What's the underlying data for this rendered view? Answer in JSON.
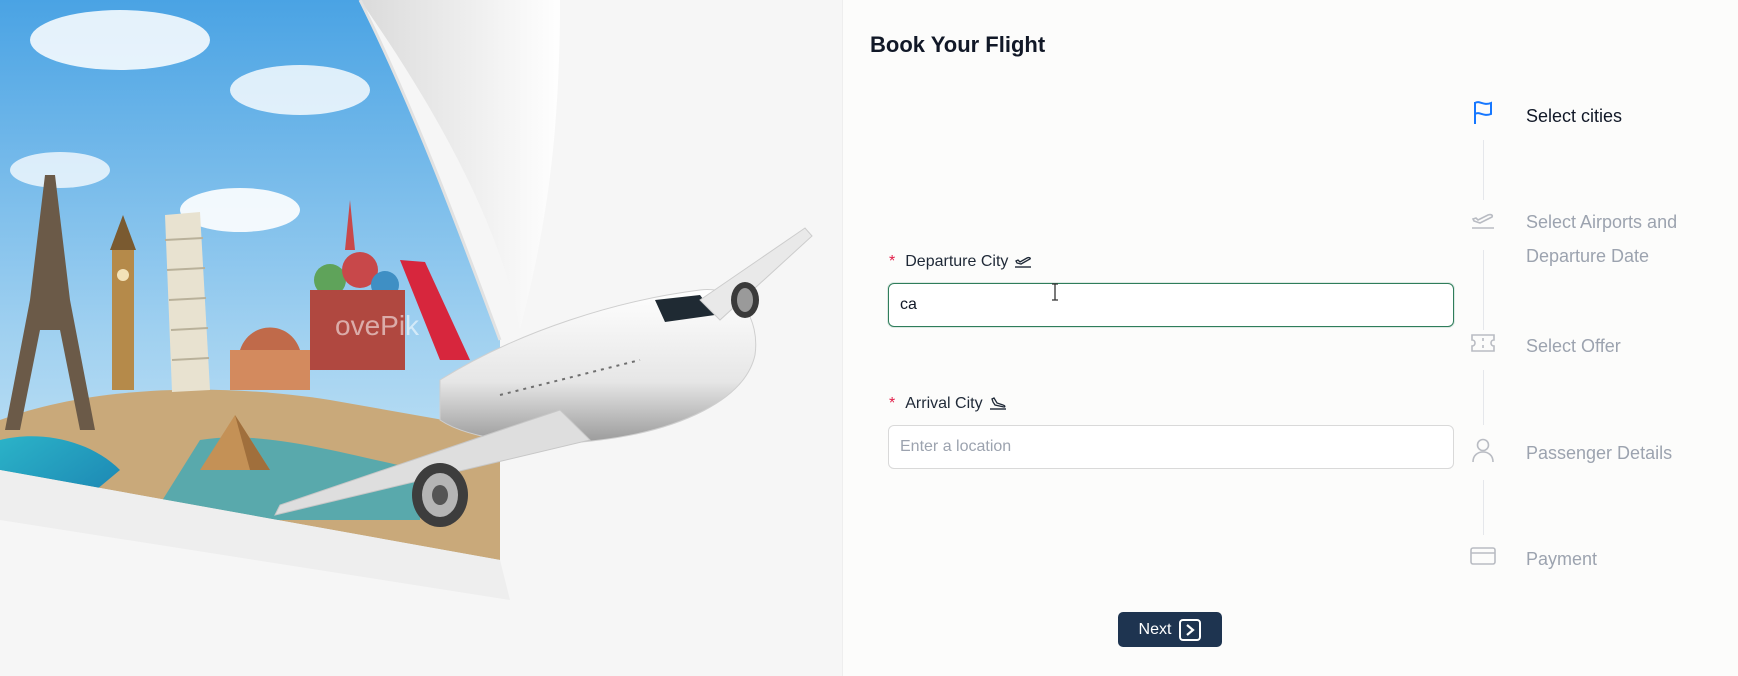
{
  "page": {
    "title": "Book Your Flight"
  },
  "hero": {
    "icon": "travel-landmarks-airplane-illustration",
    "watermark": "ovePik"
  },
  "form": {
    "departure": {
      "required_mark": "*",
      "label": "Departure City",
      "icon": "plane-departure-icon",
      "value": "ca",
      "placeholder": ""
    },
    "arrival": {
      "required_mark": "*",
      "label": "Arrival City",
      "icon": "plane-arrival-icon",
      "value": "",
      "placeholder": "Enter a location"
    }
  },
  "steps": [
    {
      "label": "Select cities",
      "icon": "flag-icon",
      "state": "current"
    },
    {
      "label": "Select Airports and Departure Date",
      "icon": "plane-departure-icon",
      "state": "pending"
    },
    {
      "label": "Select Offer",
      "icon": "ticket-icon",
      "state": "pending"
    },
    {
      "label": "Passenger Details",
      "icon": "user-icon",
      "state": "pending"
    },
    {
      "label": "Payment",
      "icon": "credit-card-icon",
      "state": "pending"
    }
  ],
  "actions": {
    "next_label": "Next",
    "next_icon": "chevron-right-square-icon"
  },
  "colors": {
    "accent": "#2f7d5b",
    "button": "#1e3450",
    "current_step": "#1677ff",
    "muted_text": "#9ca3af",
    "required": "#e11d48"
  }
}
